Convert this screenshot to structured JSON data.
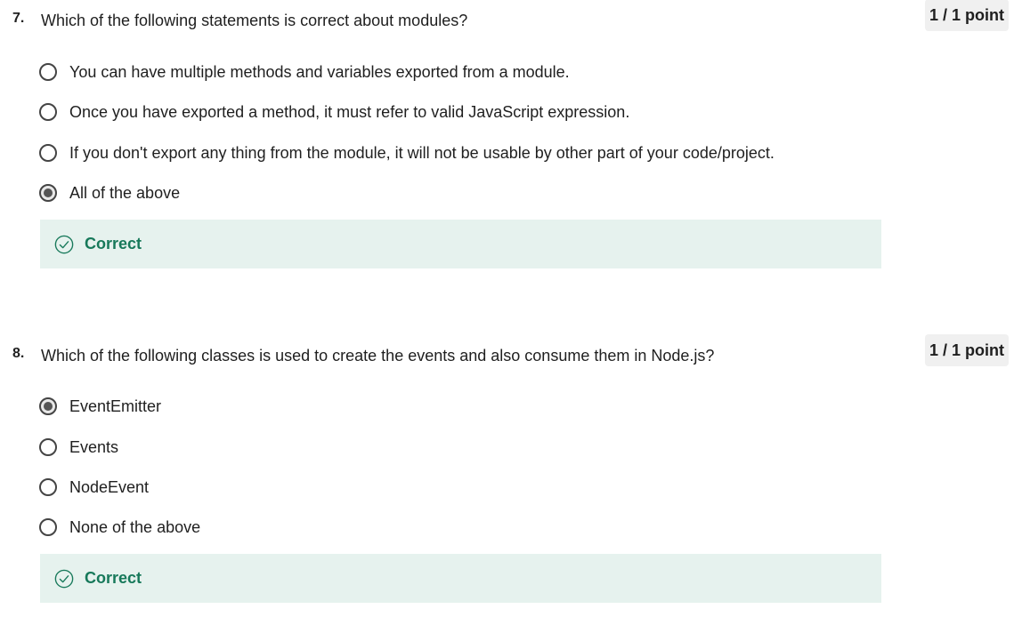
{
  "questions": [
    {
      "number": "7.",
      "text": "Which of the following statements is correct about modules?",
      "points": "1 / 1 point",
      "options": [
        {
          "label": "You can have multiple methods and variables exported from a module.",
          "selected": false
        },
        {
          "label": "Once you have exported a method, it must refer to valid JavaScript expression.",
          "selected": false
        },
        {
          "label": "If you don't export any thing from the module, it will not be usable by other part of your code/project.",
          "selected": false
        },
        {
          "label": "All of the above",
          "selected": true
        }
      ],
      "feedback": {
        "icon": "check-circle-icon",
        "label": "Correct"
      }
    },
    {
      "number": "8.",
      "text": "Which of the following classes is used to create the events and also consume them in Node.js?",
      "points": "1 / 1 point",
      "options": [
        {
          "label": "EventEmitter",
          "selected": true
        },
        {
          "label": "Events",
          "selected": false
        },
        {
          "label": "NodeEvent",
          "selected": false
        },
        {
          "label": "None of the above",
          "selected": false
        }
      ],
      "feedback": {
        "icon": "check-circle-icon",
        "label": "Correct"
      }
    }
  ],
  "colors": {
    "correct_text": "#17795a",
    "correct_bg": "#e6f2ee",
    "badge_bg": "#f0f0f0"
  }
}
